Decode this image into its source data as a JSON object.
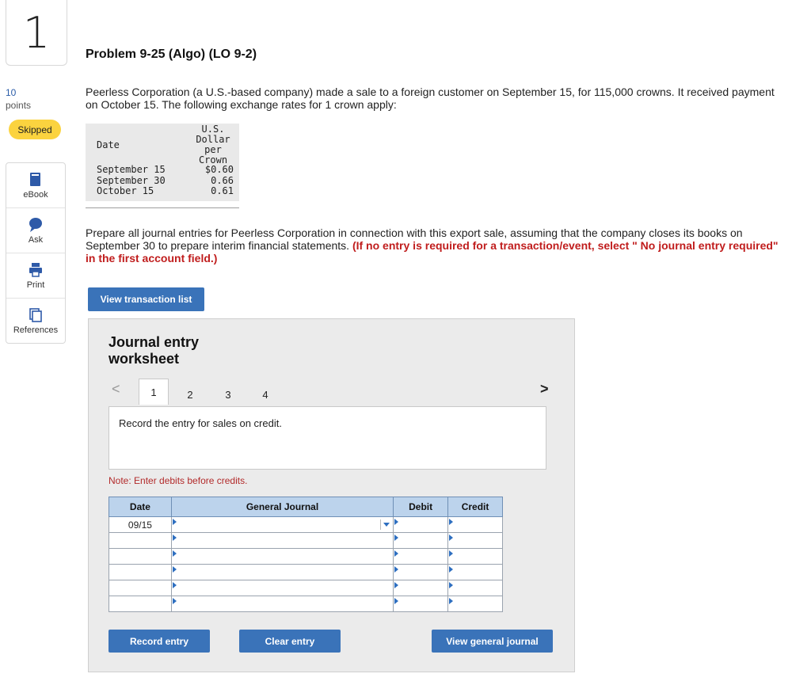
{
  "question": {
    "number": "1",
    "points_value": "10",
    "points_label": "points",
    "status_badge": "Skipped"
  },
  "tools": [
    {
      "label": "eBook",
      "icon": "book-icon"
    },
    {
      "label": "Ask",
      "icon": "chat-bubble-icon"
    },
    {
      "label": "Print",
      "icon": "printer-icon"
    },
    {
      "label": "References",
      "icon": "documents-icon"
    }
  ],
  "problem": {
    "title": "Problem 9-25 (Algo) (LO 9-2)",
    "intro": "Peerless Corporation (a U.S.-based company) made a sale to a foreign customer on September 15, for 115,000 crowns. It received payment on October 15. The following exchange rates for 1 crown apply:",
    "instructions": "Prepare all journal entries for Peerless Corporation in connection with this export sale, assuming that the company closes its books on September 30 to prepare interim financial statements.",
    "instructions_note": "(If no entry is required for a transaction/event, select \" No journal entry required\" in the first account field.)"
  },
  "rates_table": {
    "header_date": "Date",
    "header_rate_lines": [
      "U.S.",
      "Dollar",
      "per",
      "Crown"
    ],
    "rows": [
      {
        "date": "September 15",
        "rate": "$0.60"
      },
      {
        "date": "September 30",
        "rate": "0.66"
      },
      {
        "date": "October 15",
        "rate": "0.61"
      }
    ]
  },
  "buttons": {
    "view_transactions": "View transaction list",
    "record_entry": "Record entry",
    "clear_entry": "Clear entry",
    "view_general_journal": "View general journal"
  },
  "worksheet": {
    "title": "Journal entry worksheet",
    "tabs": [
      "1",
      "2",
      "3",
      "4"
    ],
    "active_tab": "1",
    "prompt": "Record the entry for sales on credit.",
    "note": "Note: Enter debits before credits.",
    "columns": [
      "Date",
      "General Journal",
      "Debit",
      "Credit"
    ],
    "rows": [
      {
        "date": "09/15",
        "account": "",
        "debit": "",
        "credit": ""
      },
      {
        "date": "",
        "account": "",
        "debit": "",
        "credit": ""
      },
      {
        "date": "",
        "account": "",
        "debit": "",
        "credit": ""
      },
      {
        "date": "",
        "account": "",
        "debit": "",
        "credit": ""
      },
      {
        "date": "",
        "account": "",
        "debit": "",
        "credit": ""
      },
      {
        "date": "",
        "account": "",
        "debit": "",
        "credit": ""
      }
    ]
  },
  "colors": {
    "accent_button": "#3a73b9",
    "badge_yellow": "#fbd33f",
    "instruction_red": "#c01d1d",
    "table_header": "#bcd3ec"
  }
}
